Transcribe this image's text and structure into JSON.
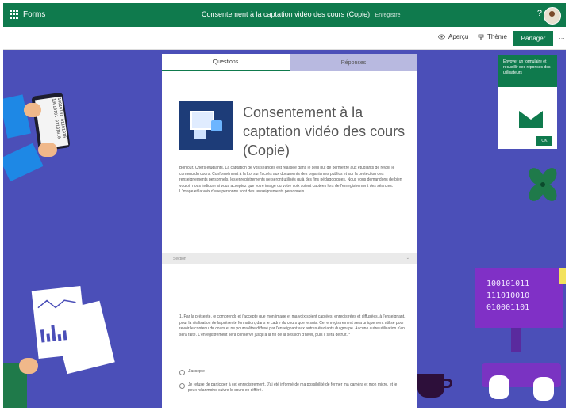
{
  "app": {
    "name": "Forms",
    "document_title": "Consentement à la captation vidéo des cours (Copie)",
    "save_status": "Enregistré",
    "help_label": "?"
  },
  "toolbar": {
    "preview_label": "Aperçu",
    "theme_label": "Thème",
    "share_label": "Partager",
    "more_label": "…"
  },
  "tabs": [
    {
      "label": "Questions",
      "active": true
    },
    {
      "label": "Réponses",
      "active": false
    }
  ],
  "form": {
    "title": "Consentement à la captation vidéo des cours (Copie)",
    "description": "Bonjour, Chers étudiants, La captation de vos séances est réalisée dans le seul but de permettre aux étudiants de revoir le contenu du cours. Conformément à la Loi sur l'accès aux documents des organismes publics et sur la protection des renseignements personnels, les enregistrements ne seront utilisés qu'à des fins pédagogiques. Nous vous demandons de bien vouloir nous indiquer si vous acceptez que votre image ou votre voix soient captées lors de l'enregistrement des séances. L'image et la voix d'une personne sont des renseignements personnels.",
    "section_label": "Section",
    "question": "1. Par la présente, je comprends et j'accepte que mon image et ma voix soient captées, enregistrées et diffusées, à l'enseignant, pour la réalisation de la présente formation, dans le cadre du cours que je suis. Cet enregistrement sera uniquement utilisé pour revoir le contenu du cours et ne pourra être diffusé par l'enseignant aux autres étudiants du groupe. Aucune autre utilisation n'en sera faite. L'enregistrement sera conservé jusqu'à la fin de la session d'hiver, puis il sera détruit. *",
    "options": [
      "J'accepte",
      "Je refuse de participer à cet enregistrement. J'ai été informé de ma possibilité de fermer ma caméra et mon micro, et je peux néanmoins suivre le cours en différé."
    ]
  },
  "notification": {
    "text": "Envoyer un formulaire et recueillir des réponses des utilisateurs",
    "ok_label": "OK"
  },
  "decor": {
    "monitor_binary": [
      "100101011",
      "111010010",
      "010001101"
    ],
    "tablet_code": "10010101 01101010 10010101 01101010"
  },
  "colors": {
    "brand": "#0f7a4d",
    "background": "#4b4fb8",
    "monitor": "#8030c6"
  }
}
